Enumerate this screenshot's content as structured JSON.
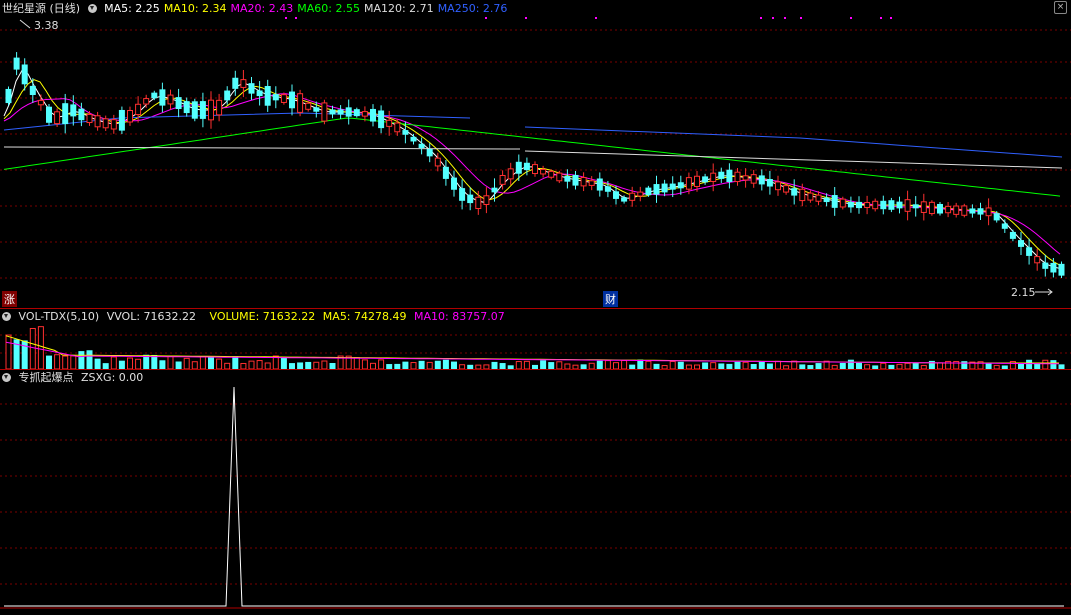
{
  "main": {
    "stock_name": "世纪星源",
    "period": "(日线)",
    "indicators": [
      {
        "label": "MA5: 2.25",
        "color": "#ffffff"
      },
      {
        "label": "MA10: 2.34",
        "color": "#ffff00"
      },
      {
        "label": "MA20: 2.43",
        "color": "#ff00ff"
      },
      {
        "label": "MA60: 2.55",
        "color": "#00ff00"
      },
      {
        "label": "MA120: 2.71",
        "color": "#dddddd"
      },
      {
        "label": "MA250: 2.76",
        "color": "#3060ff"
      }
    ],
    "high_label": "3.38",
    "low_label": "2.15",
    "marker_zhang": "涨",
    "marker_cai": "财"
  },
  "volume": {
    "name": "VOL-TDX(5,10)",
    "vvol": "VVOL: 71632.22",
    "volume": "VOLUME: 71632.22",
    "ma5": "MA5: 74278.49",
    "ma10": "MA10: 83757.07"
  },
  "indicator": {
    "name": "专抓起爆点",
    "value": "ZSXG: 0.00"
  },
  "colors": {
    "up": "#ff3030",
    "down": "#54ffff",
    "grid": "#7a0000",
    "ma5": "#ffffff",
    "ma10": "#ffff00",
    "ma20": "#ff00ff",
    "ma60": "#00ff00",
    "ma120": "#dddddd",
    "ma250": "#3060ff"
  },
  "chart_data": {
    "type": "candlestick",
    "ma_current": {
      "ma5": 2.25,
      "ma10": 2.34,
      "ma20": 2.43,
      "ma60": 2.55,
      "ma120": 2.71,
      "ma250": 2.76
    },
    "high": 3.38,
    "low": 2.15,
    "volume_current": 71632.22,
    "volume_ma5": 74278.49,
    "volume_ma10": 83757.07,
    "zsxg_current": 0.0
  }
}
